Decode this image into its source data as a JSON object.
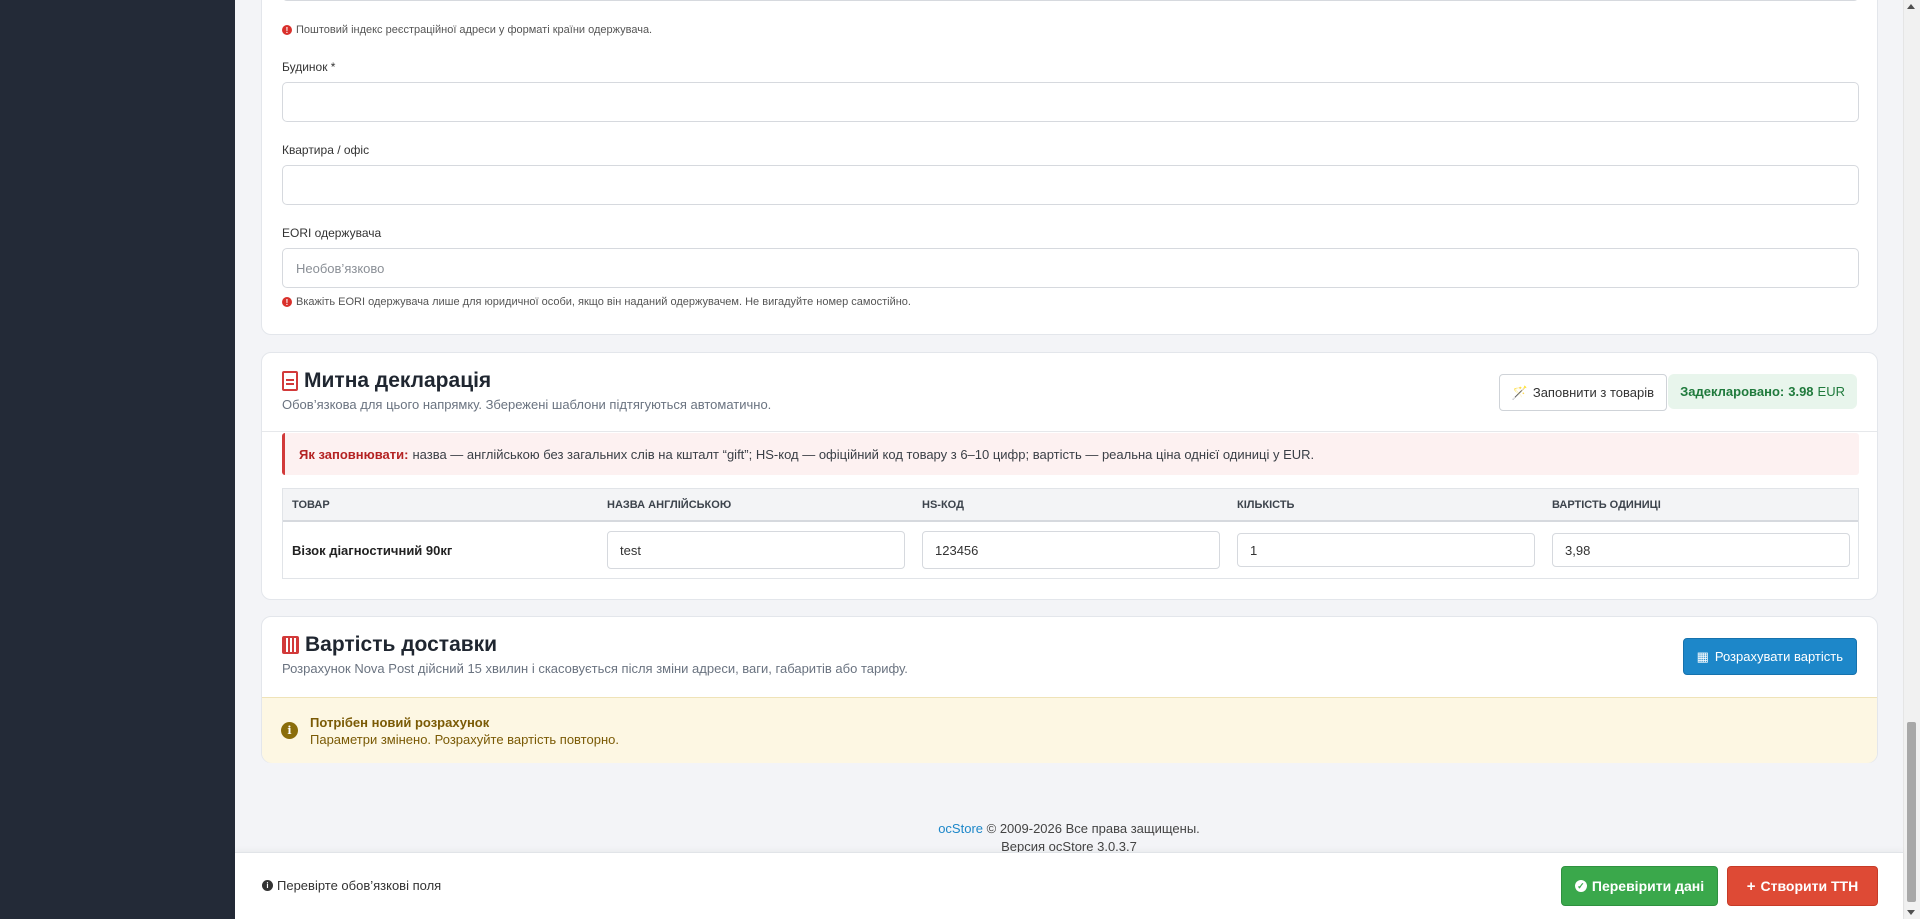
{
  "address_card": {
    "postal_hint": "Поштовий індекс реєстраційної адреси у форматі країни одержувача.",
    "house_label": "Будинок *",
    "house_value": "",
    "apartment_label": "Квартира / офіс",
    "apartment_value": "",
    "eori_label": "EORI одержувача",
    "eori_placeholder": "Необов’язково",
    "eori_hint": "Вкажіть EORI одержувача лише для юридичної особи, якщо він наданий одержувачем. Не вигадуйте номер самостійно."
  },
  "customs_card": {
    "title": "Митна декларація",
    "subtitle": "Обов’язкова для цього напрямку. Збережені шаблони підтягуються автоматично.",
    "fill_button": "Заповнити з товарів",
    "declared_label": "Задекларовано:",
    "declared_value": "3.98",
    "declared_currency": "EUR",
    "how_label": "Як заповнювати:",
    "how_text": "назва — англійською без загальних слів на кшталт “gift”; HS-код — офіційний код товару з 6–10 цифр; вартість — реальна ціна однієї одиниці у EUR.",
    "columns": [
      "Товар",
      "Назва англійською",
      "HS-код",
      "Кількість",
      "Вартість одиниці"
    ],
    "rows": [
      {
        "product": "Візок діагностичний 90кг",
        "name_en": "test",
        "hs_code": "123456",
        "quantity": "1",
        "unit_price": "3,98"
      }
    ]
  },
  "delivery_card": {
    "title": "Вартість доставки",
    "subtitle": "Розрахунок Nova Post дійсний 15 хвилин і скасовується після зміни адреси, ваги, габаритів або тарифу.",
    "calc_button": "Розрахувати вартість",
    "notice_title": "Потрібен новий розрахунок",
    "notice_text": "Параметри змінено. Розрахуйте вартість повторно."
  },
  "footer": {
    "brand": "ocStore",
    "copyright": "© 2009-2026 Все права защищены.",
    "version": "Версия ocStore 3.0.3.7"
  },
  "bottom_bar": {
    "check_note": "Перевірте обов’язкові поля",
    "verify_button": "Перевірити дані",
    "create_button": "Створити ТТН"
  },
  "colors": {
    "sidebar": "#232a37",
    "primary": "#1d87c9",
    "success": "#3aa84b",
    "danger": "#de4a35"
  }
}
